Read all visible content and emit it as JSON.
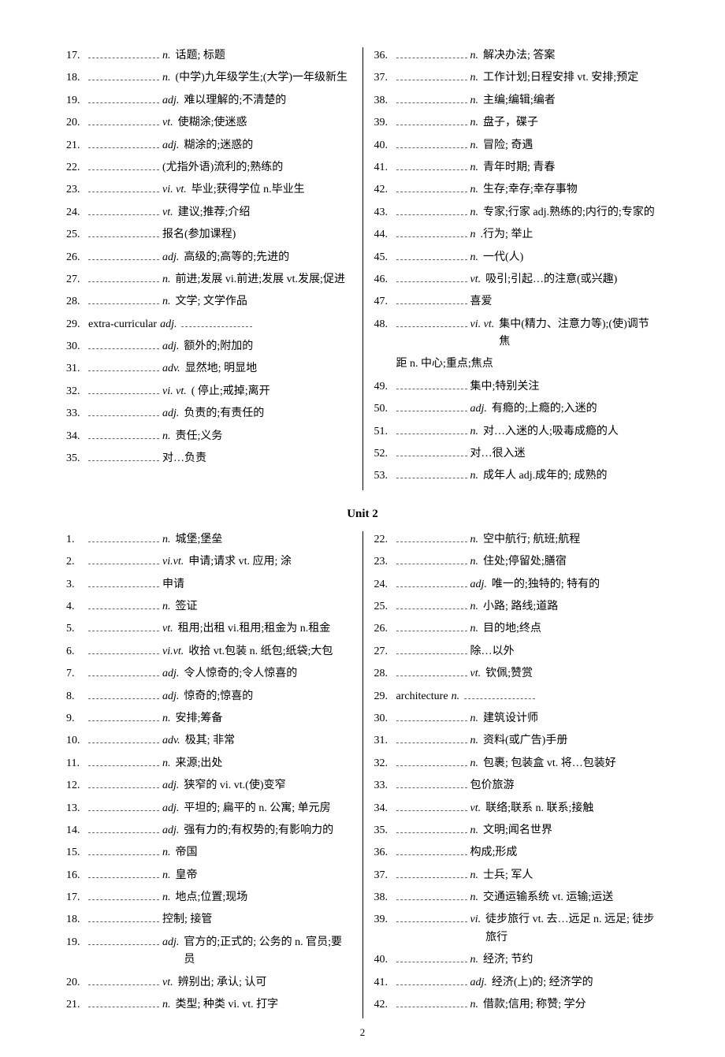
{
  "section1": {
    "left": [
      {
        "n": "17.",
        "pos": "n.",
        "def": "话题; 标题"
      },
      {
        "n": "18.",
        "pos": "n.",
        "def": "(中学)九年级学生;(大学)一年级新生"
      },
      {
        "n": "19.",
        "pos": "adj.",
        "def": "难以理解的;不清楚的"
      },
      {
        "n": "20.",
        "pos": "vt.",
        "def": "使糊涂;使迷惑"
      },
      {
        "n": "21.",
        "pos": "adj.",
        "def": "糊涂的;迷惑的"
      },
      {
        "n": "22.",
        "pos": "",
        "def": "(尤指外语)流利的;熟练的"
      },
      {
        "n": "23.",
        "pos": "vi. vt.",
        "def": "毕业;获得学位 n.毕业生"
      },
      {
        "n": "24.",
        "pos": "vt.",
        "def": "建议;推荐;介绍"
      },
      {
        "n": "25.",
        "pos": "",
        "def": "报名(参加课程)"
      },
      {
        "n": "26.",
        "pos": "adj.",
        "def": "高级的;高等的;先进的"
      },
      {
        "n": "27.",
        "pos": "n.",
        "def": "前进;发展 vi.前进;发展 vt.发展;促进"
      },
      {
        "n": "28.",
        "pos": "n.",
        "def": "文学; 文学作品"
      },
      {
        "n": "29.",
        "pre": "extra-curricular",
        "pos": "adj.",
        "def": "",
        "trail_blank": true
      },
      {
        "n": "30.",
        "pos": "adj.",
        "def": "额外的;附加的"
      },
      {
        "n": "31.",
        "pos": "adv.",
        "def": "显然地; 明显地"
      },
      {
        "n": "32.",
        "pos": "vi. vt.",
        "def": "( 停止;戒掉;离开"
      },
      {
        "n": "33.",
        "pos": "adj.",
        "def": "负责的;有责任的"
      },
      {
        "n": "34.",
        "pos": "n.",
        "def": "责任;义务"
      },
      {
        "n": "35.",
        "pos": "",
        "def": "对…负责"
      }
    ],
    "right": [
      {
        "n": "36.",
        "pos": "n.",
        "def": "解决办法; 答案"
      },
      {
        "n": "37.",
        "pos": "n.",
        "def": "工作计划;日程安排 vt. 安排;预定"
      },
      {
        "n": "38.",
        "pos": "n.",
        "def": "主编;编辑;编者"
      },
      {
        "n": "39.",
        "pos": "n.",
        "def": "盘子，碟子"
      },
      {
        "n": "40.",
        "pos": "n.",
        "def": "冒险; 奇遇"
      },
      {
        "n": "41.",
        "pos": "n.",
        "def": "青年时期; 青春"
      },
      {
        "n": "42.",
        "pos": "n.",
        "def": "生存;幸存;幸存事物"
      },
      {
        "n": "43.",
        "pos": "n.",
        "def": "专家;行家 adj.熟练的;内行的;专家的"
      },
      {
        "n": "44.",
        "pos": "n",
        "def": ".行为; 举止"
      },
      {
        "n": "45.",
        "pos": "n.",
        "def": "一代(人)"
      },
      {
        "n": "46.",
        "pos": "vt.",
        "def": "吸引;引起…的注意(或兴趣)"
      },
      {
        "n": "47.",
        "pos": "",
        "def": "喜爱"
      },
      {
        "n": "48.",
        "pos": "vi. vt.",
        "def": "集中(精力、注意力等);(使)调节焦"
      },
      {
        "indent": true,
        "def": "距 n. 中心;重点;焦点"
      },
      {
        "n": "49.",
        "pos": "",
        "def": "集中;特别关注"
      },
      {
        "n": "50.",
        "pos": "adj.",
        "def": "有瘾的;上瘾的;入迷的"
      },
      {
        "n": "51.",
        "pos": "n.",
        "def": "对…入迷的人;吸毒成瘾的人"
      },
      {
        "n": "52.",
        "pos": "",
        "def": "对…很入迷"
      },
      {
        "n": "53.",
        "pos": "n.",
        "def": "成年人  adj.成年的; 成熟的"
      }
    ]
  },
  "unit2_title": "Unit 2",
  "section2": {
    "left": [
      {
        "n": "1.",
        "pos": "n.",
        "def": "城堡;堡垒"
      },
      {
        "n": "2.",
        "pos": "vi.vt.",
        "def": "申请;请求 vt. 应用; 涂"
      },
      {
        "n": "3.",
        "pos": "",
        "def": "申请"
      },
      {
        "n": "4.",
        "pos": "n.",
        "def": "签证"
      },
      {
        "n": "5.",
        "pos": "vt.",
        "def": "租用;出租  vi.租用;租金为  n.租金"
      },
      {
        "n": "6.",
        "pos": "vi.vt.",
        "def": "收拾 vt.包装 n. 纸包;纸袋;大包"
      },
      {
        "n": "7.",
        "pos": "adj.",
        "def": "令人惊奇的;令人惊喜的"
      },
      {
        "n": "8.",
        "pos": "adj.",
        "def": "惊奇的;惊喜的"
      },
      {
        "n": "9.",
        "pos": "n.",
        "def": "安排;筹备"
      },
      {
        "n": "10.",
        "pos": "adv.",
        "def": "极其; 非常"
      },
      {
        "n": "11.",
        "pos": "n.",
        "def": "来源;出处"
      },
      {
        "n": "12.",
        "pos": "adj.",
        "def": "狭窄的 vi. vt.(使)变窄"
      },
      {
        "n": "13.",
        "pos": "adj.",
        "def": "平坦的; 扁平的  n. 公寓; 单元房"
      },
      {
        "n": "14.",
        "pos": "adj.",
        "def": "强有力的;有权势的;有影响力的"
      },
      {
        "n": "15.",
        "pos": "n.",
        "def": "帝国"
      },
      {
        "n": "16.",
        "pos": "n.",
        "def": "皇帝"
      },
      {
        "n": "17.",
        "pos": "n.",
        "def": "地点;位置;现场"
      },
      {
        "n": "18.",
        "pos": "",
        "def": "控制; 接管"
      },
      {
        "n": "19.",
        "pos": "adj.",
        "def": "官方的;正式的; 公务的  n. 官员;要员"
      },
      {
        "n": "20.",
        "pos": "vt.",
        "def": "辨别出; 承认; 认可"
      },
      {
        "n": "21.",
        "pos": "n.",
        "def": "类型; 种类  vi.  vt. 打字"
      }
    ],
    "right": [
      {
        "n": "22.",
        "pos": "n.",
        "def": "空中航行; 航班;航程"
      },
      {
        "n": "23.",
        "pos": "n.",
        "def": "住处;停留处;膳宿"
      },
      {
        "n": "24.",
        "pos": "adj.",
        "def": "唯一的;独特的; 特有的"
      },
      {
        "n": "25.",
        "pos": "n.",
        "def": "小路; 路线;道路"
      },
      {
        "n": "26.",
        "pos": "n.",
        "def": "目的地;终点"
      },
      {
        "n": "27.",
        "pos": "",
        "def": "除…以外"
      },
      {
        "n": "28.",
        "pos": "vt.",
        "def": "钦佩;赞赏"
      },
      {
        "n": "29.",
        "pre": "architecture",
        "pos": "n.",
        "def": "",
        "trail_blank": true
      },
      {
        "n": "30.",
        "pos": "n.",
        "def": "建筑设计师"
      },
      {
        "n": "31.",
        "pos": "n.",
        "def": "资料(或广告)手册"
      },
      {
        "n": "32.",
        "pos": "n.",
        "def": "包裹; 包装盒  vt. 将…包装好"
      },
      {
        "n": "33.",
        "pos": "",
        "def": "包价旅游"
      },
      {
        "n": "34.",
        "pos": "vt.",
        "def": " 联络;联系  n. 联系;接触"
      },
      {
        "n": "35.",
        "pos": "n.",
        "def": "文明;闻名世界"
      },
      {
        "n": "36.",
        "pos": "",
        "def": "构成;形成"
      },
      {
        "n": "37.",
        "pos": "n.",
        "def": "士兵; 军人"
      },
      {
        "n": "38.",
        "pos": "n.",
        "def": "交通运输系统   vt. 运输;运送"
      },
      {
        "n": "39.",
        "pos": "vi.",
        "def": "徒步旅行 vt. 去…远足 n. 远足; 徒步旅行"
      },
      {
        "n": "40.",
        "pos": "n.",
        "def": "经济; 节约"
      },
      {
        "n": "41.",
        "pos": "adj.",
        "def": "经济(上)的; 经济学的"
      },
      {
        "n": "42.",
        "pos": "n.",
        "def": "借款;信用; 称赞; 学分"
      }
    ]
  },
  "page_number": "2"
}
